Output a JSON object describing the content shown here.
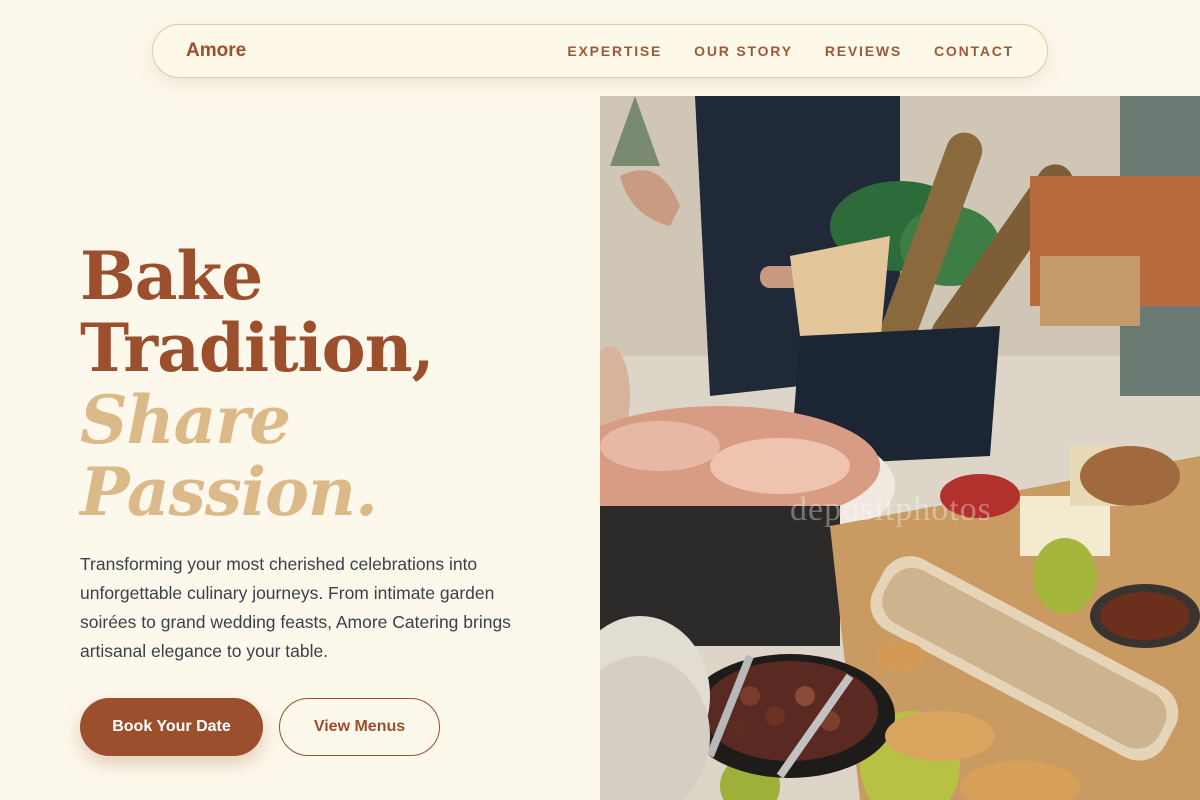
{
  "nav": {
    "brand": "Amore",
    "links": [
      "EXPERTISE",
      "OUR STORY",
      "REVIEWS",
      "CONTACT"
    ]
  },
  "hero": {
    "headline_line1": "Bake",
    "headline_line2": "Tradition,",
    "headline_accent1": "Share",
    "headline_accent2": "Passion.",
    "description": "Transforming your most cherished celebrations into unforgettable culinary journeys. From intimate garden soirées to grand wedding feasts, Amore Catering brings artisanal elegance to your table.",
    "primary_button": "Book Your Date",
    "secondary_button": "View Menus",
    "image_watermark": "depositphotos"
  },
  "colors": {
    "background": "#fdf8ec",
    "brand": "#9b4f2c",
    "accent": "#dcb988",
    "text": "#3a414c"
  }
}
